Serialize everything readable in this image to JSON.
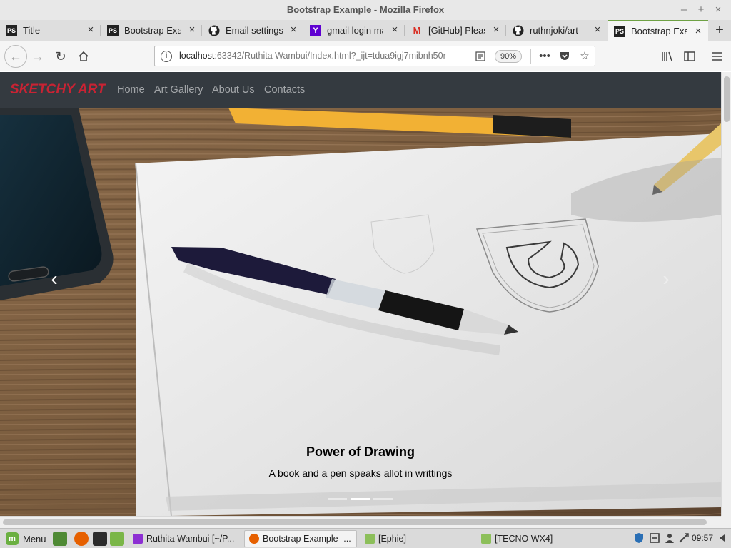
{
  "window": {
    "title": "Bootstrap Example - Mozilla Firefox",
    "controls": [
      "–",
      "+",
      "×"
    ]
  },
  "tabs": [
    {
      "label": "Title",
      "favicon": "PS"
    },
    {
      "label": "Bootstrap Exa",
      "favicon": "PS"
    },
    {
      "label": "Email settings",
      "favicon": "github"
    },
    {
      "label": "gmail login ma",
      "favicon": "Y"
    },
    {
      "label": "[GitHub] Please",
      "favicon": "M"
    },
    {
      "label": "ruthnjoki/art",
      "favicon": "github"
    },
    {
      "label": "Bootstrap Exar",
      "favicon": "PS"
    }
  ],
  "address": {
    "url_host": "localhost",
    "url_rest": ":63342/Ruthita Wambui/Index.html?_ijt=tdua9igj7mibnh50r",
    "zoom": "90%"
  },
  "site": {
    "brand": "SKETCHY ART",
    "nav": [
      "Home",
      "Art Gallery",
      "About Us",
      "Contacts"
    ],
    "caption_title": "Power of Drawing",
    "caption_text": "A book and a pen speaks allot in writtings",
    "prev": "‹",
    "next": "›"
  },
  "taskbar": {
    "menu": "Menu",
    "tasks": [
      "Ruthita Wambui [~/P...",
      "Bootstrap Example -...",
      "[Ephie]",
      "[TECNO WX4]"
    ],
    "clock": "09:57"
  }
}
